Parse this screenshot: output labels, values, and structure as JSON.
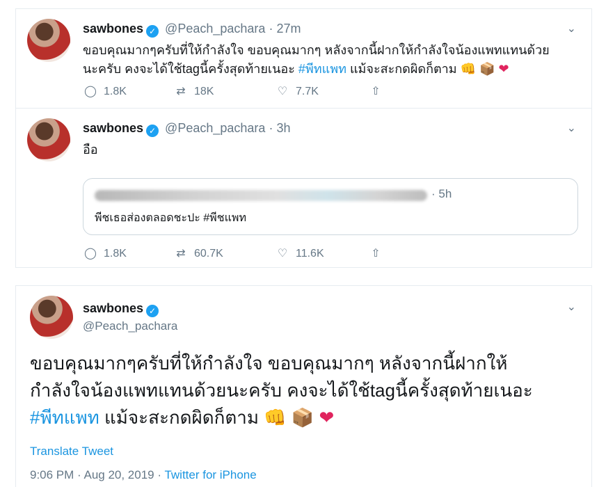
{
  "tweet1": {
    "name": "sawbones",
    "handle": "@Peach_pachara",
    "separator": "·",
    "time": "27m",
    "text_line1": "ขอบคุณมากๆครับที่ให้กำลังใจ ขอบคุณมากๆ หลังจากนี้ฝากให้กำลังใจน้องแพทแทนด้วย",
    "text_line2a": "นะครับ คงจะได้ใช้tagนี้ครั้งสุดท้ายเนอะ ",
    "hashtag": "#พีทแพท",
    "text_line2b": " แม้จะสะกดผิดก็ตาม ",
    "emoji_fist": "👊",
    "emoji_box": "📦",
    "emoji_heart": "❤",
    "replies": "1.8K",
    "retweets": "18K",
    "likes": "7.7K"
  },
  "tweet2": {
    "name": "sawbones",
    "handle": "@Peach_pachara",
    "separator": "·",
    "time": "3h",
    "text": "อือ",
    "quote": {
      "time": "· 5h",
      "text": "พีชเธอส่องตลอดชะปะ #พีชแพท"
    },
    "replies": "1.8K",
    "retweets": "60.7K",
    "likes": "11.6K"
  },
  "focused": {
    "name": "sawbones",
    "handle": "@Peach_pachara",
    "line1": "ขอบคุณมากๆครับที่ให้กำลังใจ ขอบคุณมากๆ หลังจากนี้ฝากให้",
    "line2": "กำลังใจน้องแพทแทนด้วยนะครับ คงจะได้ใช้tagนี้ครั้งสุดท้ายเนอะ",
    "hashtag": "#พีทแพท",
    "line3": " แม้จะสะกดผิดก็ตาม ",
    "emoji_fist": "👊",
    "emoji_box": "📦",
    "emoji_heart": "❤",
    "translate": "Translate Tweet",
    "timestamp": "9:06 PM · Aug 20, 2019 · ",
    "client": "Twitter for iPhone"
  },
  "icons": {
    "verified": "✓",
    "chevron": "⌄",
    "reply": "◯",
    "retweet": "⇄",
    "like": "♡",
    "share": "⇧"
  }
}
